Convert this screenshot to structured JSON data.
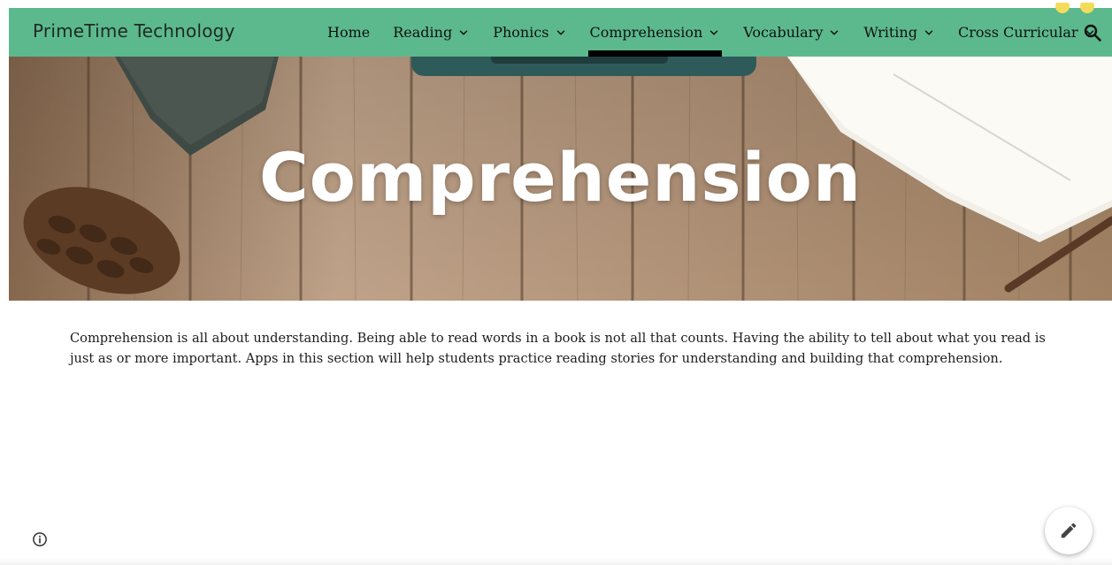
{
  "header": {
    "site_title": "PrimeTime Technology",
    "nav": [
      {
        "label": "Home",
        "has_menu": false,
        "active": false
      },
      {
        "label": "Reading",
        "has_menu": true,
        "active": false
      },
      {
        "label": "Phonics",
        "has_menu": true,
        "active": false
      },
      {
        "label": "Comprehension",
        "has_menu": true,
        "active": true
      },
      {
        "label": "Vocabulary",
        "has_menu": true,
        "active": false
      },
      {
        "label": "Writing",
        "has_menu": true,
        "active": false
      },
      {
        "label": "Cross Curricular",
        "has_menu": true,
        "active": false
      }
    ],
    "search_icon": "search-icon",
    "bar_color": "#5cb98e"
  },
  "hero": {
    "title": "Comprehension"
  },
  "content": {
    "intro": "Comprehension is all about understanding. Being able to read words in a book is not all that counts. Having the ability to tell about what you read is just as or more important. Apps in this section will help students practice reading stories for understanding and building that comprehension."
  },
  "footer": {
    "info_icon": "info-icon",
    "edit_icon": "pencil-icon"
  }
}
